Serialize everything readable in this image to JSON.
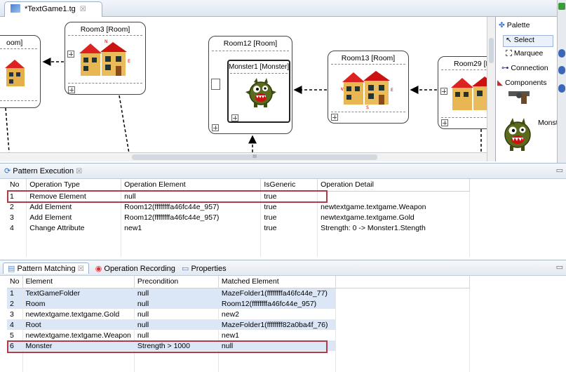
{
  "editor": {
    "tab_title": "*TextGame1.tg",
    "close_glyph": "☒",
    "scroll_indicator": "III",
    "rooms": [
      {
        "title": "oom]"
      },
      {
        "title": "Room3 [Room]"
      },
      {
        "title": "Room12 [Room]"
      },
      {
        "title": "Room13 [Room]"
      },
      {
        "title": "Room29 [F"
      }
    ],
    "monster": {
      "title": "Monster1 [Monster]"
    },
    "compass": {
      "n": "N",
      "s": "S",
      "e": "E",
      "w": "W"
    }
  },
  "palette": {
    "title": "Palette",
    "select": "Select",
    "marquee": "Marquee",
    "connection": "Connection",
    "components": "Components",
    "monster_label": "Monster"
  },
  "pattern_execution": {
    "title": "Pattern Execution",
    "columns": [
      "No",
      "Operation Type",
      "Operation Element",
      "IsGeneric",
      "Operation Detail"
    ],
    "rows": [
      [
        "1",
        "Remove Element",
        "null",
        "true",
        ""
      ],
      [
        "2",
        "Add Element",
        "Room12(ffffffffa46fc44e_957)",
        "true",
        "newtextgame.textgame.Weapon"
      ],
      [
        "3",
        "Add Element",
        "Room12(ffffffffa46fc44e_957)",
        "true",
        "newtextgame.textgame.Gold"
      ],
      [
        "4",
        "Change Attribute",
        "new1",
        "true",
        "Strength: 0 -> Monster1.Stength"
      ]
    ]
  },
  "pattern_matching": {
    "tabs": [
      "Pattern Matching",
      "Operation Recording",
      "Properties"
    ],
    "columns": [
      "No",
      "Element",
      "Precondition",
      "Matched Element"
    ],
    "rows": [
      [
        "1",
        "TextGameFolder",
        "null",
        "MazeFolder1(ffffffffa46fc44e_77)"
      ],
      [
        "2",
        "Room",
        "null",
        "Room12(ffffffffa46fc44e_957)"
      ],
      [
        "3",
        "newtextgame.textgame.Gold",
        "null",
        "new2"
      ],
      [
        "4",
        "Root",
        "null",
        "MazeFolder1(ffffffff82a0ba4f_76)"
      ],
      [
        "5",
        "newtextgame.textgame.Weapon",
        "null",
        "new1"
      ],
      [
        "6",
        "Monster",
        "Strength > 1000",
        "null"
      ]
    ]
  }
}
